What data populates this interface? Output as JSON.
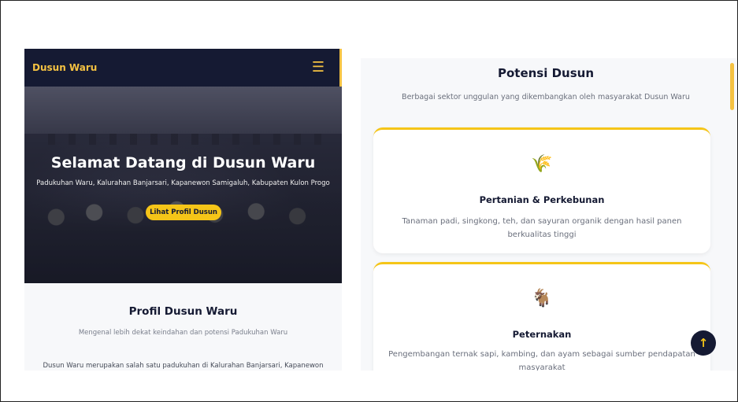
{
  "left": {
    "brand": "Dusun Waru",
    "menu_icon": "☰",
    "hero": {
      "title": "Selamat Datang di Dusun Waru",
      "subtitle": "Padukuhan Waru, Kalurahan Banjarsari, Kapanewon Samigaluh, Kabupaten Kulon Progo",
      "button": "Lihat Profil Dusun"
    },
    "profil": {
      "title": "Profil Dusun Waru",
      "subtitle": "Mengenal lebih dekat keindahan dan potensi Padukuhan Waru",
      "text": "Dusun Waru merupakan salah satu padukuhan di Kalurahan Banjarsari, Kapanewon"
    }
  },
  "right": {
    "title": "Potensi Dusun",
    "subtitle": "Berbagai sektor unggulan yang dikembangkan oleh masyarakat Dusun Waru",
    "cards": [
      {
        "icon": "🌾",
        "icon_name": "wheat-icon",
        "title": "Pertanian & Perkebunan",
        "desc": "Tanaman padi, singkong, teh, dan sayuran organik dengan hasil panen berkualitas tinggi"
      },
      {
        "icon": "🐐",
        "icon_name": "goat-icon",
        "title": "Peternakan",
        "desc": "Pengembangan ternak sapi, kambing, dan ayam sebagai sumber pendapatan masyarakat"
      }
    ]
  },
  "back_to_top": "↑",
  "colors": {
    "navy": "#151a33",
    "accent": "#f5c518"
  }
}
